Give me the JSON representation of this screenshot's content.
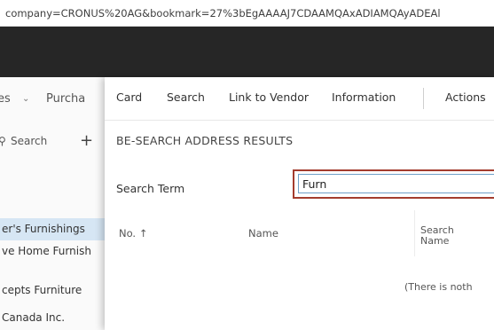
{
  "browser": {
    "url_fragment": "company=CRONUS%20AG&bookmark=27%3bEgAAAAJ7CDAAMQAxADIAMQAyADEAl"
  },
  "background_page": {
    "nav": {
      "item1": "es",
      "item2": "Purcha"
    },
    "actions": {
      "search_label": "Search"
    },
    "rows": [
      "er's Furnishings",
      "ve Home Furnish",
      "cepts Furniture",
      "Canada Inc."
    ]
  },
  "dialog": {
    "menu": [
      "Card",
      "Search",
      "Link to Vendor",
      "Information",
      "Actions"
    ],
    "title": "BE-SEARCH ADDRESS RESULTS",
    "field_label": "Search Term",
    "search_value": "Furn",
    "columns": {
      "no": "No. ↑",
      "name": "Name",
      "search_name_1": "Search",
      "search_name_2": "Name"
    },
    "empty_text": "(There is noth"
  },
  "colors": {
    "topbar": "#262626",
    "highlight_border": "#a33c2e",
    "selected_row": "#d6e6f4"
  }
}
